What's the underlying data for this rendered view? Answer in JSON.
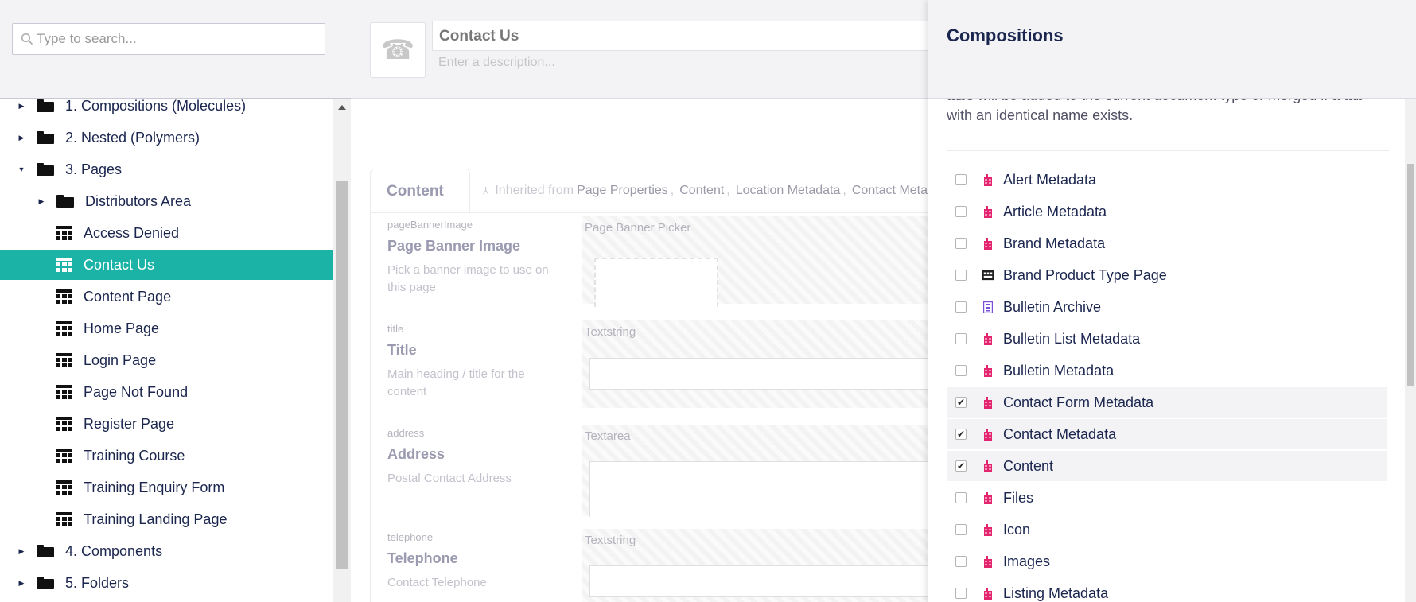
{
  "search": {
    "placeholder": "Type to search..."
  },
  "tree": {
    "items": [
      {
        "label": "1. Compositions (Molecules)",
        "type": "folder",
        "caret": "right"
      },
      {
        "label": "2. Nested (Polymers)",
        "type": "folder",
        "caret": "right"
      },
      {
        "label": "3. Pages",
        "type": "folder",
        "caret": "down"
      },
      {
        "label": "Distributors Area",
        "type": "folder",
        "caret": "right"
      },
      {
        "label": "Access Denied",
        "type": "doc"
      },
      {
        "label": "Contact Us",
        "type": "doc",
        "active": true
      },
      {
        "label": "Content Page",
        "type": "doc"
      },
      {
        "label": "Home Page",
        "type": "doc"
      },
      {
        "label": "Login Page",
        "type": "doc"
      },
      {
        "label": "Page Not Found",
        "type": "doc"
      },
      {
        "label": "Register Page",
        "type": "doc"
      },
      {
        "label": "Training Course",
        "type": "doc"
      },
      {
        "label": "Training Enquiry Form",
        "type": "doc"
      },
      {
        "label": "Training Landing Page",
        "type": "doc"
      },
      {
        "label": "4. Components",
        "type": "folder",
        "caret": "right"
      },
      {
        "label": "5. Folders",
        "type": "folder",
        "caret": "right"
      }
    ],
    "active_color": "#1ab3a6"
  },
  "editor": {
    "name": "Contact Us",
    "description_placeholder": "Enter a description...",
    "icon": "phone-icon",
    "tab_label": "Content",
    "inherited_prefix": "Inherited from",
    "inherited_sources": [
      "Page Properties",
      "Content",
      "Location Metadata",
      "Contact Meta"
    ],
    "properties": [
      {
        "alias": "pageBannerImage",
        "name": "Page Banner Image",
        "description": "Pick a banner image to use on this page",
        "editor": "Page Banner Picker"
      },
      {
        "alias": "title",
        "name": "Title",
        "description": "Main heading / title for the content",
        "editor": "Textstring"
      },
      {
        "alias": "address",
        "name": "Address",
        "description": "Postal Contact Address",
        "editor": "Textarea"
      },
      {
        "alias": "telephone",
        "name": "Telephone",
        "description": "Contact Telephone",
        "editor": "Textstring"
      }
    ]
  },
  "compositions": {
    "title": "Compositions",
    "intro_line1": "tabs will be added to the current document type or merged if a tab",
    "intro_line2": "with an identical name exists.",
    "accent_color": "#e3246e",
    "items": [
      {
        "label": "Alert Metadata",
        "checked": false,
        "icon": "metadata-icon"
      },
      {
        "label": "Article Metadata",
        "checked": false,
        "icon": "metadata-icon"
      },
      {
        "label": "Brand Metadata",
        "checked": false,
        "icon": "metadata-icon"
      },
      {
        "label": "Brand Product Type Page",
        "checked": false,
        "icon": "page-grid-icon"
      },
      {
        "label": "Bulletin Archive",
        "checked": false,
        "icon": "archive-icon"
      },
      {
        "label": "Bulletin List Metadata",
        "checked": false,
        "icon": "metadata-icon"
      },
      {
        "label": "Bulletin Metadata",
        "checked": false,
        "icon": "metadata-icon"
      },
      {
        "label": "Contact Form Metadata",
        "checked": true,
        "icon": "metadata-icon"
      },
      {
        "label": "Contact Metadata",
        "checked": true,
        "icon": "metadata-icon"
      },
      {
        "label": "Content",
        "checked": true,
        "icon": "metadata-icon"
      },
      {
        "label": "Files",
        "checked": false,
        "icon": "metadata-icon"
      },
      {
        "label": "Icon",
        "checked": false,
        "icon": "metadata-icon"
      },
      {
        "label": "Images",
        "checked": false,
        "icon": "metadata-icon"
      },
      {
        "label": "Listing Metadata",
        "checked": false,
        "icon": "metadata-icon"
      }
    ]
  }
}
